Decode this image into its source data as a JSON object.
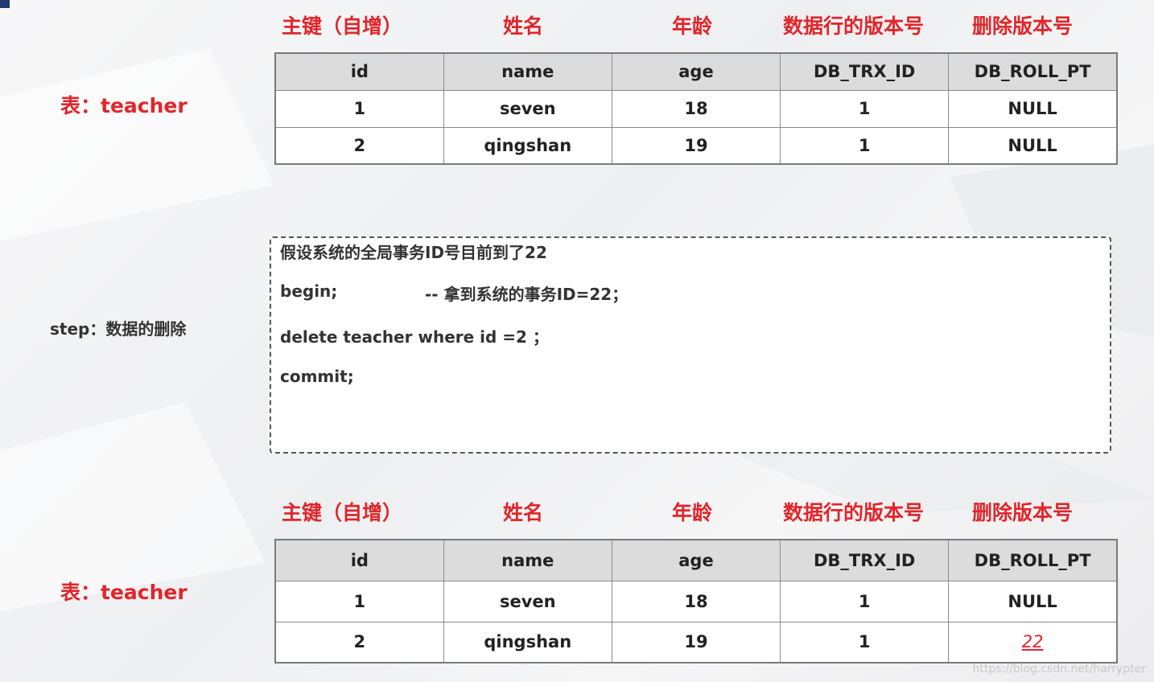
{
  "headers": [
    "主键（自增）",
    "姓名",
    "年龄",
    "数据行的版本号",
    "删除版本号"
  ],
  "table_label": "表：teacher",
  "columns": [
    "id",
    "name",
    "age",
    "DB_TRX_ID",
    "DB_ROLL_PT"
  ],
  "table1": {
    "rows": [
      [
        "1",
        "seven",
        "18",
        "1",
        "NULL"
      ],
      [
        "2",
        "qingshan",
        "19",
        "1",
        "NULL"
      ]
    ]
  },
  "step": {
    "label": "step：数据的删除",
    "lines": {
      "note": "假设系统的全局事务ID号目前到了22",
      "begin": "begin;",
      "begin_comment": "--  拿到系统的事务ID=22；",
      "delete": "delete teacher where id =2  ；",
      "commit": "commit;"
    }
  },
  "table2": {
    "rows": [
      [
        "1",
        "seven",
        "18",
        "1",
        "NULL"
      ],
      [
        "2",
        "qingshan",
        "19",
        "1",
        "22"
      ]
    ]
  },
  "watermark": "https://blog.csdn.net/harrypter",
  "colors": {
    "accent_red": "#e0262b",
    "header_gray": "#dcdcdc",
    "corner_navy": "#1f3a6b"
  }
}
